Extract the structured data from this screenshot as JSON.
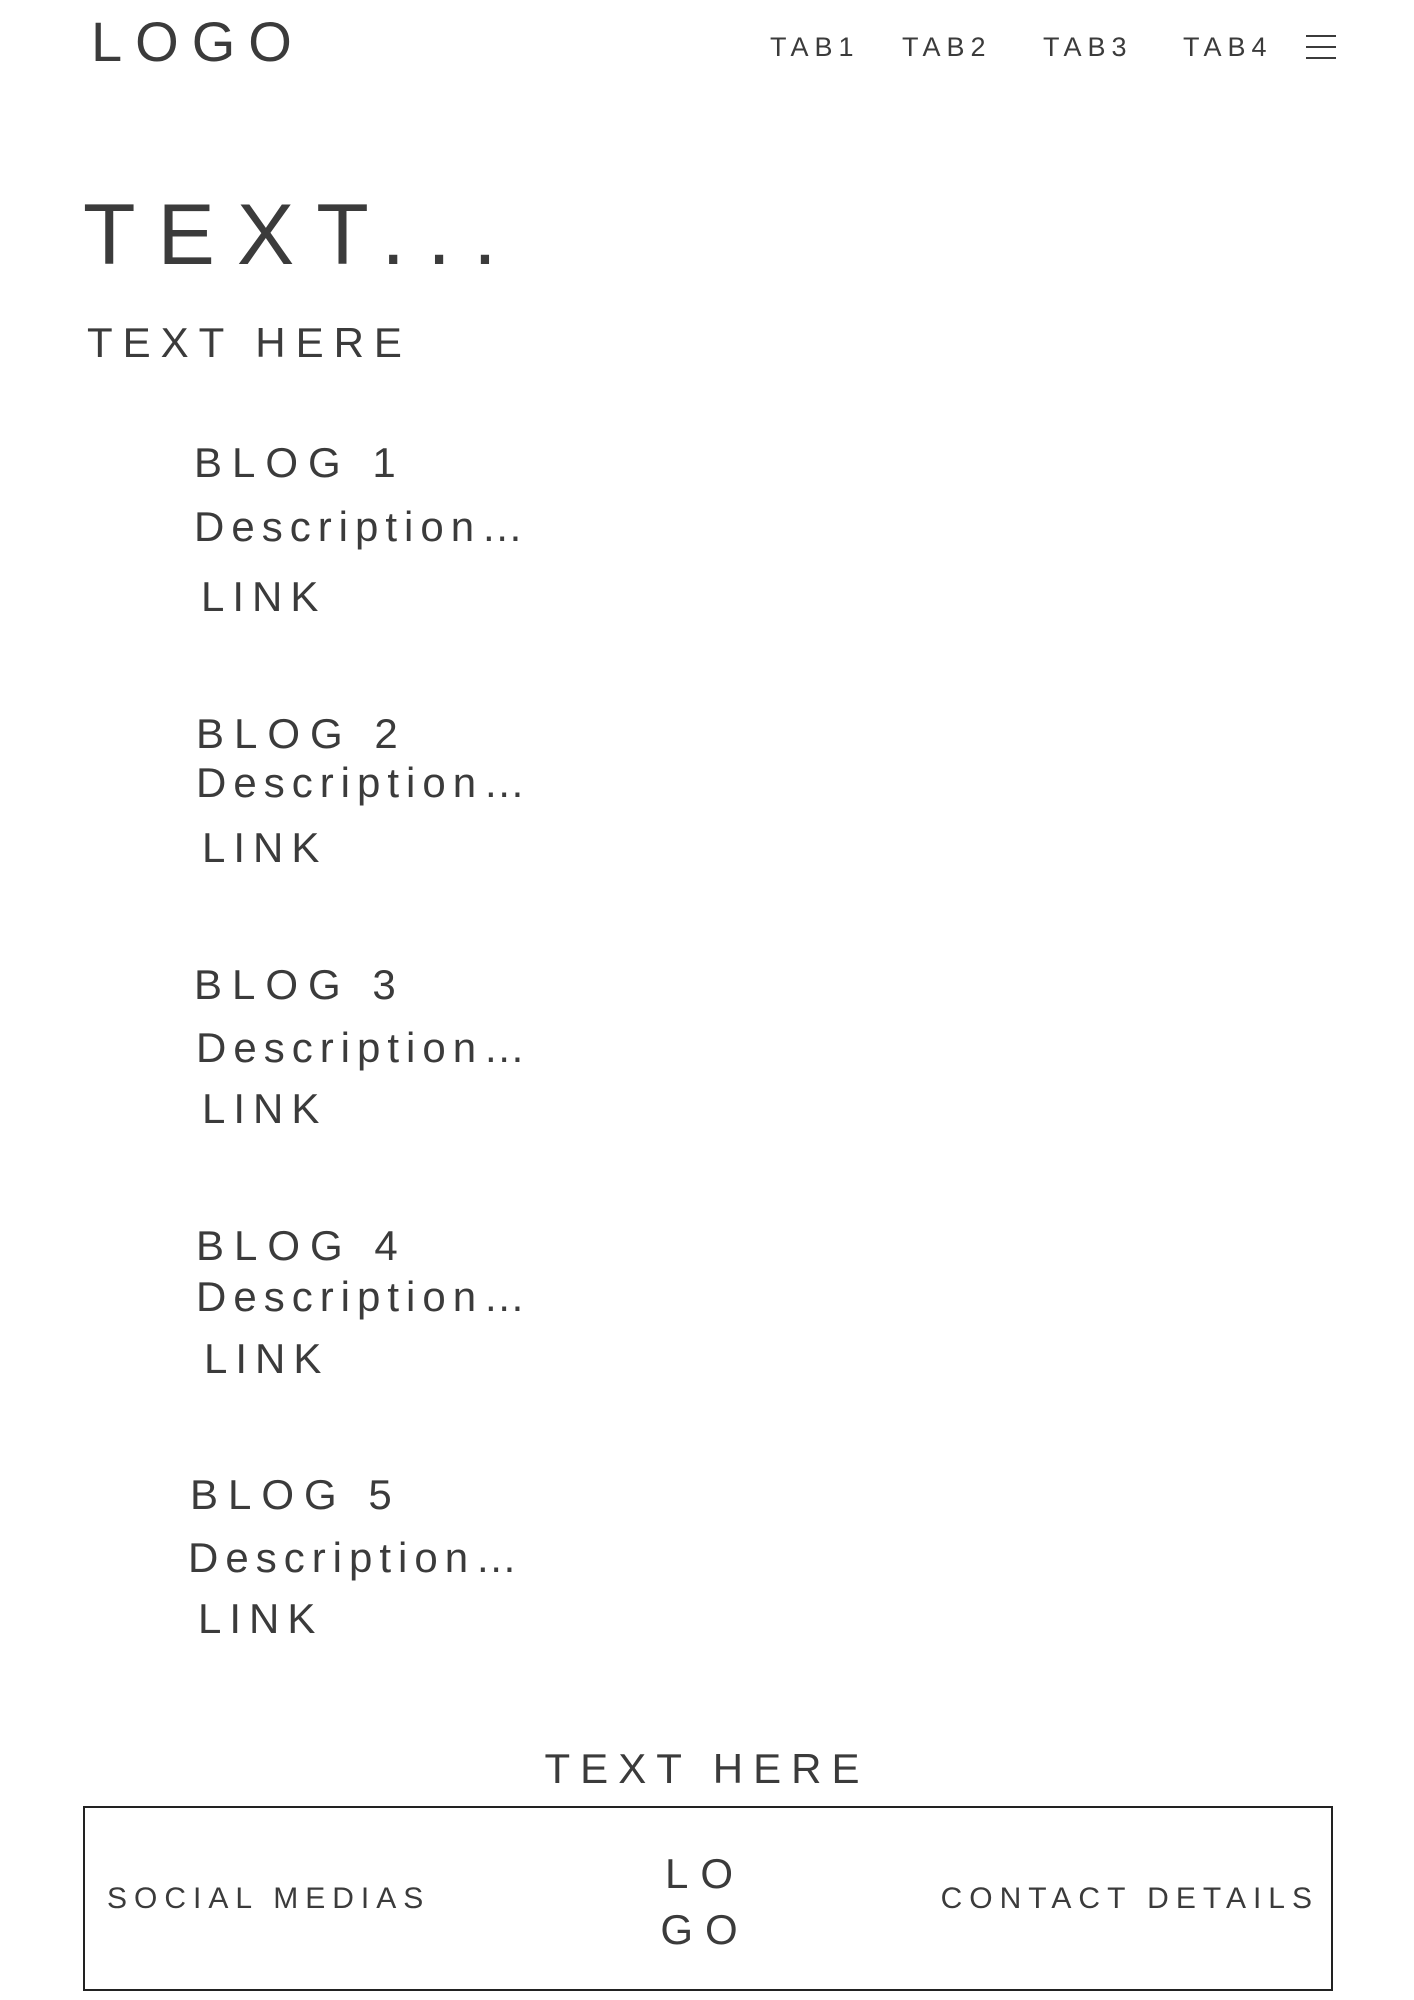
{
  "header": {
    "logo": "LOGO",
    "tabs": [
      "TAB1",
      "TAB2",
      "TAB3",
      "TAB4"
    ],
    "menu_icon": "hamburger-menu-icon"
  },
  "hero": {
    "title": "TEXT...",
    "subtitle": "TEXT HERE"
  },
  "blogs": [
    {
      "title": "BLOG 1",
      "description": "Description…",
      "link": "LINK"
    },
    {
      "title": "BLOG 2",
      "description": "Description…",
      "link": "LINK"
    },
    {
      "title": "BLOG 3",
      "description": "Description…",
      "link": "LINK"
    },
    {
      "title": "BLOG 4",
      "description": "Description…",
      "link": "LINK"
    },
    {
      "title": "BLOG 5",
      "description": "Description…",
      "link": "LINK"
    }
  ],
  "footer": {
    "text": "TEXT HERE",
    "social": "SOCIAL MEDIAS",
    "logo_line1": "LO",
    "logo_line2": "GO",
    "contact": "CONTACT DETAILS"
  },
  "colors": {
    "text": "#3b3b3b",
    "border": "#222222",
    "background": "#ffffff"
  }
}
